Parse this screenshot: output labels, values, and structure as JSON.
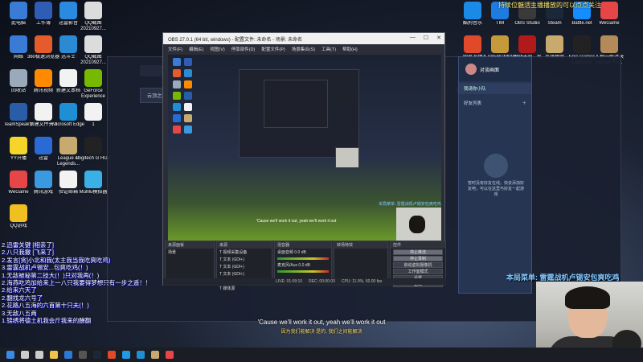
{
  "banner_top": "持续位魅活主播播放的可以点点关注",
  "desktop_left": [
    {
      "label": "此电脑",
      "icon": "computer-icon",
      "color": "#3a7bd5"
    },
    {
      "label": "工作簿",
      "icon": "app-icon",
      "color": "#2f5db5"
    },
    {
      "label": "迅雷影音",
      "icon": "player-icon",
      "color": "#2a8ae0"
    },
    {
      "label": "QQ截图 20210927...",
      "icon": "screenshot-file-icon",
      "color": "#dcdcdc"
    },
    {
      "label": "网络",
      "icon": "network-icon",
      "color": "#3a7bd5"
    },
    {
      "label": "360极速浏览器",
      "icon": "browser-icon",
      "color": "#e65b2c"
    },
    {
      "label": "迅斗士",
      "icon": "app-icon",
      "color": "#2b8ad4"
    },
    {
      "label": "QQ截图 20210927...",
      "icon": "screenshot-file-icon",
      "color": "#dcdcdc"
    },
    {
      "label": "回收站",
      "icon": "recycle-bin-icon",
      "color": "#9aaabb"
    },
    {
      "label": "腾讯视频",
      "icon": "video-icon",
      "color": "#ff8a00"
    },
    {
      "label": "新建文本档",
      "icon": "text-file-icon",
      "color": "#f2f2f2"
    },
    {
      "label": "GeForce Experience",
      "icon": "nvidia-icon",
      "color": "#76b900"
    },
    {
      "label": "TeamSpeak 3",
      "icon": "teamspeak-icon",
      "color": "#2a5da8"
    },
    {
      "label": "新建文件夹 2",
      "icon": "text-file-icon",
      "color": "#f2f2f2"
    },
    {
      "label": "Microsoft Edge",
      "icon": "edge-icon",
      "color": "#1e8fd4"
    },
    {
      "label": "1",
      "icon": "text-file-icon",
      "color": "#f2f2f2"
    },
    {
      "label": "YY开播",
      "icon": "yy-icon",
      "color": "#f5d52a"
    },
    {
      "label": "迅雷",
      "icon": "thunder-icon",
      "color": "#2a6ad5"
    },
    {
      "label": "League of Legends...",
      "icon": "lol-icon",
      "color": "#c8aa6e"
    },
    {
      "label": "Logitech G HUB",
      "icon": "logitech-icon",
      "color": "#222222"
    },
    {
      "label": "WeGame",
      "icon": "wegame-icon",
      "color": "#e64646"
    },
    {
      "label": "腾讯游戏",
      "icon": "game-icon",
      "color": "#3a9ae0"
    },
    {
      "label": "验证邮箱",
      "icon": "text-file-icon",
      "color": "#f2f2f2"
    },
    {
      "label": "MuMu模拟器",
      "icon": "mumu-icon",
      "color": "#3ab0e6"
    },
    {
      "label": "QQ游戏",
      "icon": "qq-game-icon",
      "color": "#f0c020"
    }
  ],
  "desktop_right": [
    {
      "label": "酷狗音乐",
      "icon": "kugou-icon",
      "color": "#1a8ae6"
    },
    {
      "label": "TIM",
      "icon": "tim-icon",
      "color": "#1e7ce0"
    },
    {
      "label": "OBS Studio",
      "icon": "obs-icon",
      "color": "#3a3a3a"
    },
    {
      "label": "Steam",
      "icon": "steam-icon",
      "color": "#1b2838"
    },
    {
      "label": "Battle.net",
      "icon": "battlenet-icon",
      "color": "#148eff"
    },
    {
      "label": "WeGame",
      "icon": "wegame-icon",
      "color": "#e64646"
    },
    {
      "label": "网易游戏",
      "icon": "game-icon",
      "color": "#e04a2a"
    },
    {
      "label": "PLAYERUNKNOWN'S BATTLEGR...",
      "icon": "pubg-icon",
      "color": "#c49a3a"
    },
    {
      "label": "永劫无间 - 官方...",
      "icon": "game-icon",
      "color": "#b01a1a"
    },
    {
      "label": "英雄联盟",
      "icon": "lol-icon",
      "color": "#c8aa6e"
    },
    {
      "label": "Epic Games Launcher",
      "icon": "epic-icon",
      "color": "#222222"
    },
    {
      "label": "人狼一般对决 Human Fa...",
      "icon": "game-icon",
      "color": "#b58a5a"
    },
    {
      "label": "永劫无间 代客...",
      "icon": "game-icon",
      "color": "#222222"
    },
    {
      "label": "刀剑英雄2",
      "icon": "game-icon",
      "color": "#d4a020"
    }
  ],
  "bg_window": {
    "title": "云顶之弈 (排位)",
    "tabs": [
      "云顶之弈 (排位)",
      "▾"
    ]
  },
  "obs": {
    "title": "OBS 27.0.1 (64 bit, windows) - 配置文件: 未命名 - 场景: 未命名",
    "window_controls": [
      "—",
      "☐",
      "✕"
    ],
    "menu": [
      "文件(F)",
      "编辑(E)",
      "视图(V)",
      "停靠部件(D)",
      "配置文件(P)",
      "场景集合(S)",
      "工具(T)",
      "帮助(H)"
    ],
    "preview_caption": "'Cause we'll work it out, yeah we'll work it out",
    "preview_overlay": "本局菜单: 雷霆战机卢锡安包爽吃鸡",
    "docks": {
      "scenes": {
        "header": "场景",
        "row": "场景",
        "tab": "来源面板"
      },
      "sources": {
        "header": "来源",
        "items": [
          "视频采集设备",
          "文本 (GDI+)",
          "文本 (GDI+)",
          "文本 (GDI+)",
          "显示器采集",
          "媒体源"
        ]
      },
      "mixer": {
        "header": "混音器",
        "channels": [
          {
            "name": "桌面音频",
            "level": "0.0 dB"
          },
          {
            "name": "麦克风/Aux",
            "level": "0.0 dB"
          }
        ]
      },
      "transitions": {
        "header": "转场特效"
      },
      "controls": {
        "header": "控件",
        "buttons": [
          "停止推流",
          "停止录制",
          "启动虚拟摄像机",
          "工作室模式",
          "设置",
          "退出"
        ]
      }
    },
    "status": [
      "LIVE: 01:09:10",
      "REC: 00:00:00",
      "CPU: 11.9%, 60.00 fps"
    ]
  },
  "qq": {
    "username": "对谈画面",
    "group": "我请你小队",
    "friends_label": "好友列表",
    "empty_text": "暂时没有好友在线。快去添加好友吧，可以在这里与好友一起游戏"
  },
  "chat": [
    "2.迅雷关键 [相亲了]",
    "2.八只我撒 [飞来了]",
    "2.发言[贪]小北和我(太主我当我吃爽吃鸡)",
    "3.雷霆战机卢锡安...包爽吃鸡(！)",
    "1.无敌被秘第二技大(！)只对我再(！)",
    "2.海燕吃鸡加给来上一八只我要得梦想只有一步之遥！！",
    "2.给来六天了",
    "2.翻找龙六号了",
    "2.花路八五海的六首第十只夫(！)",
    "3.无敌八五两",
    "1.锦绣将德土机我会斤我来的酬翻"
  ],
  "menu_banner": "本局菜单: 雷霆战机卢锡安包爽吃鸡",
  "lyrics": {
    "en": "'Cause we'll work it out, yeah we'll work it out",
    "cn": "因为我们能解决 是的, 我们之间能解决"
  },
  "taskbar_icons": [
    {
      "name": "start-icon",
      "color": "#3a8ae6"
    },
    {
      "name": "search-icon",
      "color": "#cccccc"
    },
    {
      "name": "task-view-icon",
      "color": "#cccccc"
    },
    {
      "name": "file-explorer-icon",
      "color": "#f0c24a"
    },
    {
      "name": "store-icon",
      "color": "#2a7ad5"
    },
    {
      "name": "obs-icon",
      "color": "#555555"
    },
    {
      "name": "steam-icon",
      "color": "#1b2838"
    },
    {
      "name": "chrome-icon",
      "color": "#e04a2a"
    },
    {
      "name": "qq-icon",
      "color": "#1e9ae6"
    },
    {
      "name": "edge-icon",
      "color": "#1e8fd4"
    },
    {
      "name": "lol-icon",
      "color": "#c8aa6e"
    },
    {
      "name": "wegame-icon",
      "color": "#e64646"
    }
  ]
}
